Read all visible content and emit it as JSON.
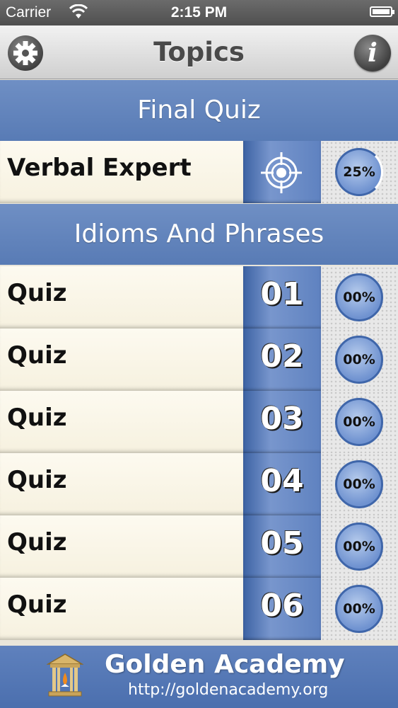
{
  "status_bar": {
    "carrier": "Carrier",
    "time": "2:15 PM"
  },
  "nav": {
    "title": "Topics",
    "settings_icon": "gear-icon",
    "info_icon": "info-icon",
    "info_glyph": "i"
  },
  "sections": [
    {
      "title": "Final Quiz"
    },
    {
      "title": "Idioms And Phrases"
    }
  ],
  "final_quiz": {
    "label": "Verbal Expert",
    "icon": "target-icon",
    "progress": "25%"
  },
  "quizzes": [
    {
      "label": "Quiz",
      "number": "01",
      "progress": "00%"
    },
    {
      "label": "Quiz",
      "number": "02",
      "progress": "00%"
    },
    {
      "label": "Quiz",
      "number": "03",
      "progress": "00%"
    },
    {
      "label": "Quiz",
      "number": "04",
      "progress": "00%"
    },
    {
      "label": "Quiz",
      "number": "05",
      "progress": "00%"
    },
    {
      "label": "Quiz",
      "number": "06",
      "progress": "00%"
    }
  ],
  "footer": {
    "name": "Golden Academy",
    "url": "http://goldenacademy.org"
  },
  "colors": {
    "section_blue": "#587bb5",
    "number_blue": "#5f82c0",
    "row_bg": "#fdfaf0"
  }
}
